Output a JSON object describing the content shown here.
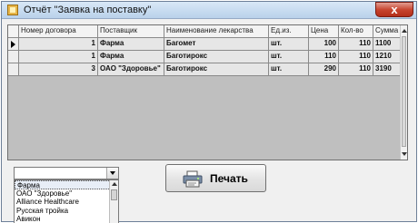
{
  "window": {
    "title": "Отчёт \"Заявка на поставку\"",
    "close_label": "x"
  },
  "grid": {
    "columns": [
      "Номер договора",
      "Поставщик",
      "Наименование лекарства",
      "Ед.из.",
      "Цена",
      "Кол-во",
      "Сумма"
    ],
    "rows": [
      [
        "1",
        "Фарма",
        "Багомет",
        "шт.",
        "100",
        "110",
        "1100"
      ],
      [
        "1",
        "Фарма",
        "Баготирокс",
        "шт.",
        "110",
        "110",
        "1210"
      ],
      [
        "3",
        "ОАО \"Здоровье\"",
        "Баготирокс",
        "шт.",
        "290",
        "110",
        "3190"
      ]
    ]
  },
  "supplier_select": {
    "value": "",
    "options": [
      "Фарма",
      "ОАО \"Здоровье\"",
      "Alliance Healthcare",
      "Русская тройка",
      "Авикон"
    ]
  },
  "print_button": {
    "label": "Печать"
  }
}
